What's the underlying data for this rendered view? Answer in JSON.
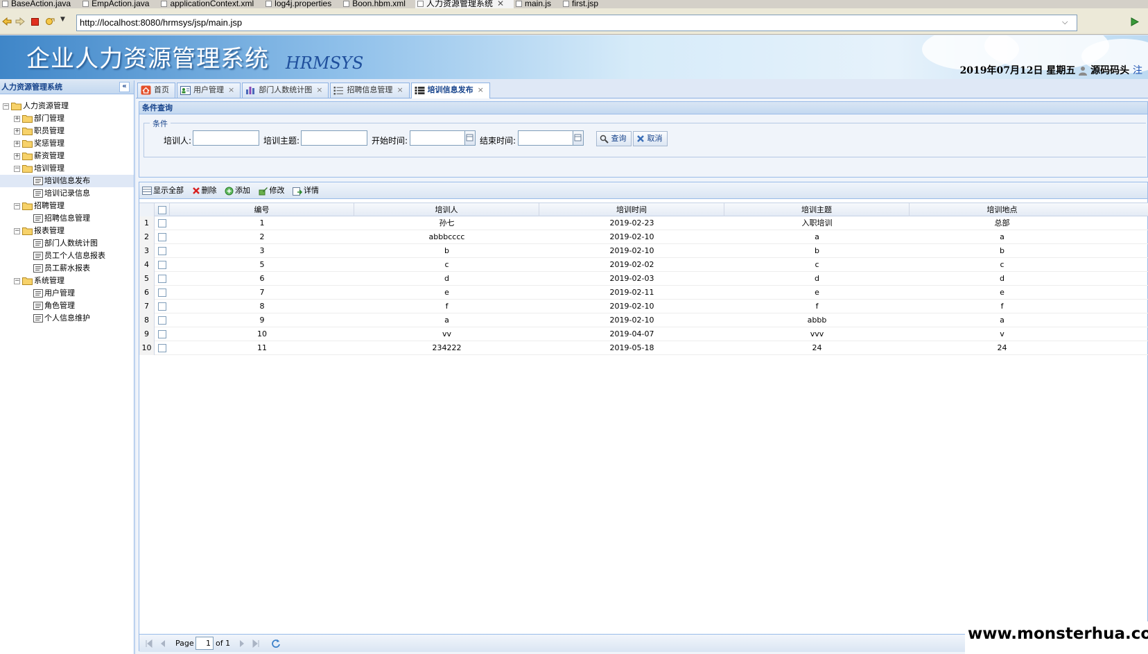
{
  "editor_tabs": [
    {
      "label": "BaseAction.java",
      "active": false
    },
    {
      "label": "EmpAction.java",
      "active": false
    },
    {
      "label": "applicationContext.xml",
      "active": false
    },
    {
      "label": "log4j.properties",
      "active": false
    },
    {
      "label": "Boon.hbm.xml",
      "active": false
    },
    {
      "label": "人力资源管理系统",
      "active": true,
      "close": "✕"
    },
    {
      "label": "main.js",
      "active": false
    },
    {
      "label": "first.jsp",
      "active": false
    }
  ],
  "browser": {
    "url": "http://localhost:8080/hrmsys/jsp/main.jsp"
  },
  "banner": {
    "title": "企业人力资源管理系统",
    "subtitle": "HRMSYS",
    "date": "2019年07月12日 星期五",
    "user": "源码码头",
    "logout": "注"
  },
  "sidebar": {
    "title": "人力资源管理系统",
    "collapse": "«",
    "tree": [
      {
        "label": "人力资源管理",
        "level": 0,
        "type": "folder",
        "expander": "−"
      },
      {
        "label": "部门管理",
        "level": 1,
        "type": "folder",
        "expander": "+"
      },
      {
        "label": "职员管理",
        "level": 1,
        "type": "folder",
        "expander": "+"
      },
      {
        "label": "奖惩管理",
        "level": 1,
        "type": "folder",
        "expander": "+"
      },
      {
        "label": "薪资管理",
        "level": 1,
        "type": "folder",
        "expander": "+"
      },
      {
        "label": "培训管理",
        "level": 1,
        "type": "folder",
        "expander": "−"
      },
      {
        "label": "培训信息发布",
        "level": 2,
        "type": "leaf",
        "selected": true
      },
      {
        "label": "培训记录信息",
        "level": 2,
        "type": "leaf"
      },
      {
        "label": "招聘管理",
        "level": 1,
        "type": "folder",
        "expander": "−"
      },
      {
        "label": "招聘信息管理",
        "level": 2,
        "type": "leaf"
      },
      {
        "label": "报表管理",
        "level": 1,
        "type": "folder",
        "expander": "−"
      },
      {
        "label": "部门人数统计图",
        "level": 2,
        "type": "leaf"
      },
      {
        "label": "员工个人信息报表",
        "level": 2,
        "type": "leaf"
      },
      {
        "label": "员工薪水报表",
        "level": 2,
        "type": "leaf"
      },
      {
        "label": "系统管理",
        "level": 1,
        "type": "folder",
        "expander": "−"
      },
      {
        "label": "用户管理",
        "level": 2,
        "type": "leaf"
      },
      {
        "label": "角色管理",
        "level": 2,
        "type": "leaf"
      },
      {
        "label": "个人信息维护",
        "level": 2,
        "type": "leaf"
      }
    ]
  },
  "tabs": [
    {
      "label": "首页",
      "icon": "home-icon",
      "closable": false,
      "active": false
    },
    {
      "label": "用户管理",
      "icon": "user-card-icon",
      "closable": true,
      "active": false
    },
    {
      "label": "部门人数统计图",
      "icon": "bar-chart-icon",
      "closable": true,
      "active": false
    },
    {
      "label": "招聘信息管理",
      "icon": "list-icon",
      "closable": true,
      "active": false
    },
    {
      "label": "培训信息发布",
      "icon": "document-list-icon",
      "closable": true,
      "active": true
    }
  ],
  "tab_close": "×",
  "query": {
    "panel_title": "条件查询",
    "legend": "条件",
    "trainer_label": "培训人:",
    "subject_label": "培训主题:",
    "start_label": "开始时间:",
    "end_label": "结束时间:",
    "trainer_value": "",
    "subject_value": "",
    "start_value": "",
    "end_value": "",
    "search_label": "查询",
    "cancel_label": "取消"
  },
  "toolbar": {
    "show_all": "显示全部",
    "delete": "删除",
    "add": "添加",
    "edit": "修改",
    "detail": "详情"
  },
  "grid": {
    "columns": [
      "编号",
      "培训人",
      "培训时间",
      "培训主题",
      "培训地点"
    ],
    "rows": [
      {
        "rn": "1",
        "id": "1",
        "trainer": "孙七",
        "date": "2019-02-23",
        "subject": "入职培训",
        "place": "总部"
      },
      {
        "rn": "2",
        "id": "2",
        "trainer": "abbbcccc",
        "date": "2019-02-10",
        "subject": "a",
        "place": "a"
      },
      {
        "rn": "3",
        "id": "3",
        "trainer": "b",
        "date": "2019-02-10",
        "subject": "b",
        "place": "b"
      },
      {
        "rn": "4",
        "id": "5",
        "trainer": "c",
        "date": "2019-02-02",
        "subject": "c",
        "place": "c"
      },
      {
        "rn": "5",
        "id": "6",
        "trainer": "d",
        "date": "2019-02-03",
        "subject": "d",
        "place": "d"
      },
      {
        "rn": "6",
        "id": "7",
        "trainer": "e",
        "date": "2019-02-11",
        "subject": "e",
        "place": "e"
      },
      {
        "rn": "7",
        "id": "8",
        "trainer": "f",
        "date": "2019-02-10",
        "subject": "f",
        "place": "f"
      },
      {
        "rn": "8",
        "id": "9",
        "trainer": "a",
        "date": "2019-02-10",
        "subject": "abbb",
        "place": "a"
      },
      {
        "rn": "9",
        "id": "10",
        "trainer": "vv",
        "date": "2019-04-07",
        "subject": "vvv",
        "place": "v"
      },
      {
        "rn": "10",
        "id": "11",
        "trainer": "234222",
        "date": "2019-05-18",
        "subject": "24",
        "place": "24"
      }
    ]
  },
  "pager": {
    "page_label": "Page",
    "page_value": "1",
    "of_label": "of 1"
  },
  "watermark": "www.monsterhua.com",
  "colors": {
    "accent": "#15428b",
    "border": "#99bbe8",
    "banner": "#3f86c8"
  }
}
